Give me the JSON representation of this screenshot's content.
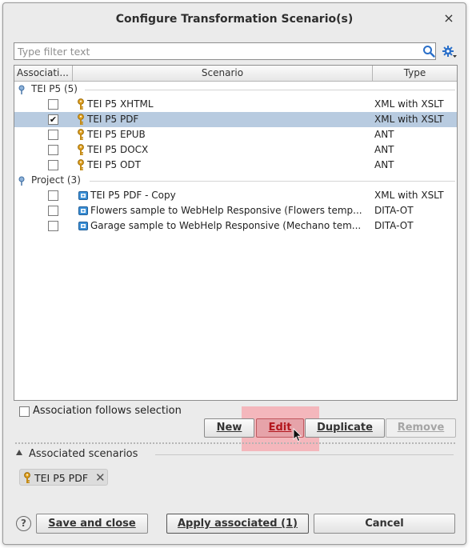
{
  "dialog": {
    "title": "Configure Transformation Scenario(s)",
    "close_symbol": "×"
  },
  "filter": {
    "placeholder": "Type filter text",
    "value": ""
  },
  "table": {
    "columns": [
      "Associati...",
      "Scenario",
      "Type"
    ],
    "groups": [
      {
        "label": "TEI P5 (5)",
        "rows": [
          {
            "checked": false,
            "check_mark": "",
            "icon": "key-icon",
            "scenario": "TEI P5 XHTML",
            "type": "XML with XSLT",
            "selected": false
          },
          {
            "checked": true,
            "check_mark": "✔",
            "icon": "key-icon",
            "scenario": "TEI P5 PDF",
            "type": "XML with XSLT",
            "selected": true
          },
          {
            "checked": false,
            "check_mark": "",
            "icon": "key-icon",
            "scenario": "TEI P5 EPUB",
            "type": "ANT",
            "selected": false
          },
          {
            "checked": false,
            "check_mark": "",
            "icon": "key-icon",
            "scenario": "TEI P5 DOCX",
            "type": "ANT",
            "selected": false
          },
          {
            "checked": false,
            "check_mark": "",
            "icon": "key-icon",
            "scenario": "TEI P5 ODT",
            "type": "ANT",
            "selected": false
          }
        ]
      },
      {
        "label": "Project (3)",
        "rows": [
          {
            "checked": false,
            "check_mark": "",
            "icon": "project-scenario-icon",
            "scenario": "TEI P5 PDF - Copy",
            "type": "XML with XSLT",
            "selected": false
          },
          {
            "checked": false,
            "check_mark": "",
            "icon": "project-scenario-icon",
            "scenario": "Flowers sample to WebHelp Responsive (Flowers temp...",
            "type": "DITA-OT",
            "selected": false
          },
          {
            "checked": false,
            "check_mark": "",
            "icon": "project-scenario-icon",
            "scenario": "Garage sample to WebHelp Responsive (Mechano tem...",
            "type": "DITA-OT",
            "selected": false
          }
        ]
      }
    ]
  },
  "association_follows_selection": {
    "label": "Association follows selection",
    "checked": false
  },
  "actions": {
    "new": "New",
    "edit": "Edit",
    "duplicate": "Duplicate",
    "remove": "Remove"
  },
  "associated": {
    "title": "Associated scenarios",
    "chips": [
      {
        "label": "TEI P5 PDF",
        "remove": "✕"
      }
    ]
  },
  "footer": {
    "help": "?",
    "save_and_close": "Save and close",
    "apply_associated": "Apply associated (1)",
    "cancel": "Cancel"
  },
  "colors": {
    "selected_row": "#b8cbe0",
    "edit_highlight": "#ff7882",
    "search_icon": "#2a6fc9",
    "gear_icon": "#2a6fc9",
    "key_icon": "#d89a1a"
  }
}
